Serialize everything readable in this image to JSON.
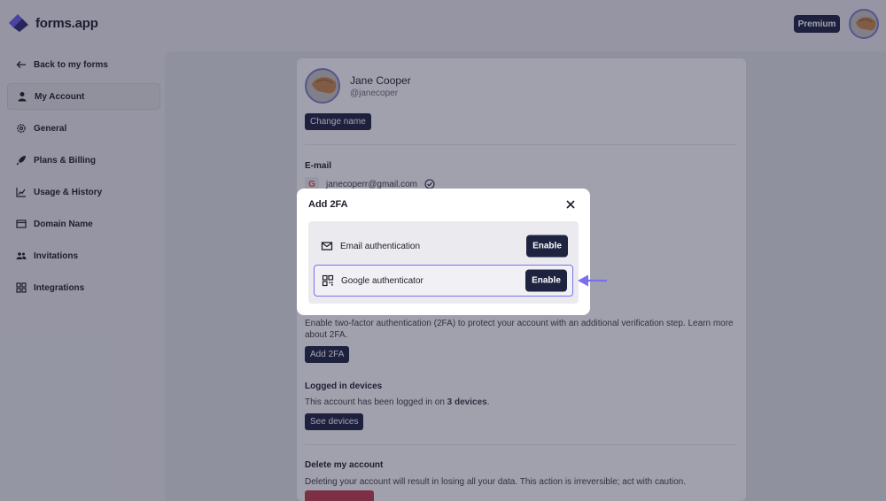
{
  "app": {
    "name": "forms.app",
    "plan_badge": "Premium"
  },
  "sidebar": {
    "items": [
      {
        "label": "Back to my forms",
        "icon": "arrow-left-icon"
      },
      {
        "label": "My Account",
        "icon": "user-icon"
      },
      {
        "label": "General",
        "icon": "gear-icon"
      },
      {
        "label": "Plans & Billing",
        "icon": "rocket-icon"
      },
      {
        "label": "Usage & History",
        "icon": "chart-icon"
      },
      {
        "label": "Domain Name",
        "icon": "browser-icon"
      },
      {
        "label": "Invitations",
        "icon": "users-icon"
      },
      {
        "label": "Integrations",
        "icon": "grid-icon"
      }
    ]
  },
  "account": {
    "name": "Jane Cooper",
    "handle": "@janecoper",
    "change_name_label": "Change name",
    "email_section": "E-mail",
    "email": "janecoperr@gmail.com",
    "twofa_text": "Enable two-factor authentication (2FA) to protect your account with an additional verification step. Learn more about 2FA.",
    "add_2fa_label": "Add 2FA",
    "devices_title": "Logged in devices",
    "devices_text_prefix": "This account has been logged in on ",
    "devices_count": "3 devices",
    "devices_text_suffix": ".",
    "see_devices_label": "See devices",
    "delete_title": "Delete my account",
    "delete_text": "Deleting your account will result in losing all your data. This action is irreversible; act with caution."
  },
  "modal": {
    "title": "Add 2FA",
    "options": [
      {
        "label": "Email authentication",
        "button": "Enable",
        "icon": "envelope-icon"
      },
      {
        "label": "Google authenticator",
        "button": "Enable",
        "icon": "qr-code-icon"
      }
    ]
  },
  "colors": {
    "primary": "#1e2340",
    "accent": "#7a6ff0",
    "danger": "#c23c4d"
  }
}
